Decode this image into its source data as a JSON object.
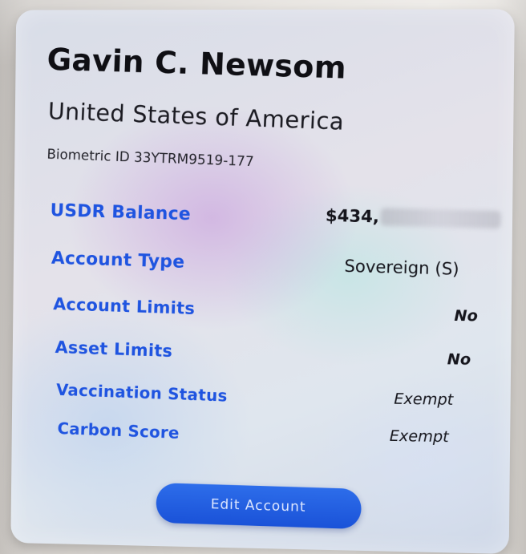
{
  "card": {
    "name": "Gavin C. Newsom",
    "country": "United States of America",
    "biometric_label": "Biometric ID",
    "biometric_id": "33YTRM9519-177"
  },
  "rows": [
    {
      "label": "USDR Balance",
      "value": "$434,",
      "value_redacted": true
    },
    {
      "label": "Account Type",
      "value": "Sovereign (S)"
    },
    {
      "label": "Account Limits",
      "value": "No"
    },
    {
      "label": "Asset Limits",
      "value": "No"
    },
    {
      "label": "Vaccination Status",
      "value": "Exempt"
    },
    {
      "label": "Carbon Score",
      "value": "Exempt"
    }
  ],
  "actions": {
    "edit_label": "Edit Account"
  },
  "colors": {
    "label_blue": "#1f54e0",
    "button_blue": "#1a52d8",
    "text_dark": "#15151c"
  }
}
